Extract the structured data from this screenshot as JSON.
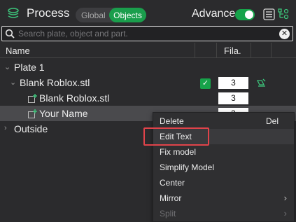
{
  "header": {
    "title": "Process",
    "seg_global": "Global",
    "seg_objects": "Objects",
    "advance_label": "Advance",
    "advance_on": true
  },
  "search": {
    "placeholder": "Search plate, object and part."
  },
  "columns": {
    "name": "Name",
    "fila": "Fila."
  },
  "tree": {
    "plate": "Plate 1",
    "object": {
      "name": "Blank Roblox.stl",
      "fila": "3"
    },
    "part1": {
      "name": "Blank Roblox.stl",
      "fila": "3"
    },
    "part2": {
      "name": "Your Name",
      "fila": "3"
    },
    "outside": "Outside"
  },
  "context_menu": {
    "delete": "Delete",
    "delete_shortcut": "Del",
    "edit_text": "Edit Text",
    "fix_model": "Fix model",
    "simplify_model": "Simplify Model",
    "center": "Center",
    "mirror": "Mirror",
    "split": "Split"
  },
  "colors": {
    "accent": "#1a9e4c",
    "highlight": "#e0434a"
  }
}
